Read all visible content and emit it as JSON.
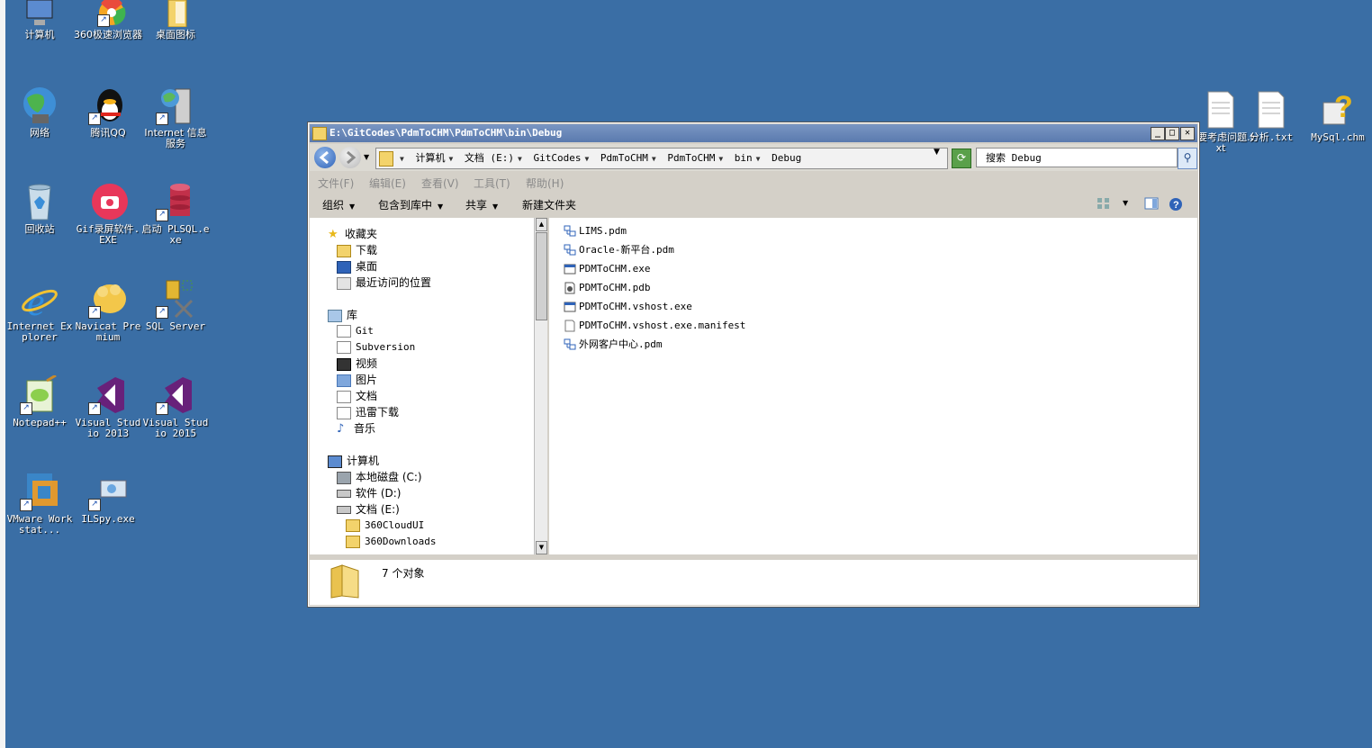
{
  "desktop": {
    "icons": [
      {
        "name": "computer",
        "label": "计算机"
      },
      {
        "name": "360-browser",
        "label": "360极速浏览器"
      },
      {
        "name": "desktop-icons-folder",
        "label": "桌面图标"
      },
      {
        "name": "network",
        "label": "网络"
      },
      {
        "name": "tencent-qq",
        "label": "腾讯QQ"
      },
      {
        "name": "internet-info-services",
        "label": "Internet 信息服务"
      },
      {
        "name": "recycle-bin",
        "label": "回收站"
      },
      {
        "name": "gif-recorder",
        "label": "Gif录屏软件.EXE"
      },
      {
        "name": "plsql",
        "label": "启动 PLSQL.exe"
      },
      {
        "name": "internet-explorer",
        "label": "Internet Explorer"
      },
      {
        "name": "navicat",
        "label": "Navicat Premium"
      },
      {
        "name": "sql-server",
        "label": "SQL Server"
      },
      {
        "name": "notepad-plus-plus",
        "label": "Notepad++"
      },
      {
        "name": "visual-studio-2013",
        "label": "Visual Studio 2013"
      },
      {
        "name": "visual-studio-2015",
        "label": "Visual Studio 2015"
      },
      {
        "name": "vmware",
        "label": "VMware Workstat..."
      },
      {
        "name": "ilspy",
        "label": "ILSpy.exe"
      },
      {
        "name": "txt-notes",
        "label": "需要考虑问题.txt"
      },
      {
        "name": "analysis-txt",
        "label": "分析.txt"
      },
      {
        "name": "mysql-chm",
        "label": "MySql.chm"
      }
    ]
  },
  "window": {
    "title": "E:\\GitCodes\\PdmToCHM\\PdmToCHM\\bin\\Debug",
    "buttons": {
      "minimize": "_",
      "maximize": "□",
      "close": "✕"
    }
  },
  "address": {
    "crumbs": [
      "计算机",
      "文档 (E:)",
      "GitCodes",
      "PdmToCHM",
      "PdmToCHM",
      "bin",
      "Debug"
    ],
    "search_placeholder": "搜索 Debug"
  },
  "menu": [
    "文件(F)",
    "编辑(E)",
    "查看(V)",
    "工具(T)",
    "帮助(H)"
  ],
  "commands": [
    "组织",
    "包含到库中",
    "共享",
    "新建文件夹"
  ],
  "nav": {
    "favorites": "收藏夹",
    "fav_items": [
      "下载",
      "桌面",
      "最近访问的位置"
    ],
    "libraries": "库",
    "lib_items": [
      "Git",
      "Subversion",
      "视频",
      "图片",
      "文档",
      "迅雷下载",
      "音乐"
    ],
    "computer": "计算机",
    "drives": [
      "本地磁盘 (C:)",
      "软件 (D:)",
      "文档 (E:)"
    ],
    "folders": [
      "360CloudUI",
      "360Downloads"
    ]
  },
  "files": [
    {
      "name": "LIMS.pdm",
      "type": "pdm"
    },
    {
      "name": "Oracle-新平台.pdm",
      "type": "pdm"
    },
    {
      "name": "PDMToCHM.exe",
      "type": "exe"
    },
    {
      "name": "PDMToCHM.pdb",
      "type": "pdb"
    },
    {
      "name": "PDMToCHM.vshost.exe",
      "type": "exe"
    },
    {
      "name": "PDMToCHM.vshost.exe.manifest",
      "type": "manifest"
    },
    {
      "name": "外网客户中心.pdm",
      "type": "pdm"
    }
  ],
  "status": {
    "text": "7 个对象"
  }
}
